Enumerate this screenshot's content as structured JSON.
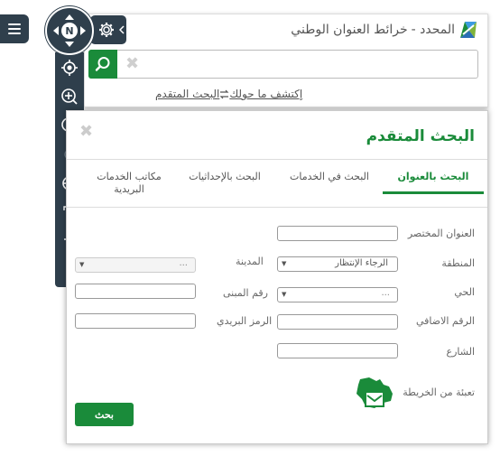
{
  "header": {
    "app_title": "خرائط العنوان الوطني",
    "title_suffix": "المحدد -",
    "compass_label": "N"
  },
  "search": {
    "value": "",
    "placeholder": "",
    "clear_symbol": "✖",
    "explore_link": "إكتشف ما حولك",
    "advanced_link": "البحث المتقدم"
  },
  "advanced_search": {
    "title": "البحث المتقدم",
    "close_symbol": "✖",
    "tabs": [
      {
        "label": "البحث بالعنوان",
        "active": true
      },
      {
        "label": "البحث في الخدمات",
        "active": false
      },
      {
        "label": "البحث بالإحداثيات",
        "active": false
      },
      {
        "label": "مكاتب الخدمات البريدية",
        "active": false
      }
    ],
    "fields": {
      "short_address_label": "العنوان المختصر",
      "region_label": "المنطقة",
      "region_value": "الرجاء الإنتظار",
      "city_label": "المدينة",
      "city_value": "...",
      "district_label": "الحي",
      "district_value": "...",
      "building_label": "رقم المبنى",
      "additional_label": "الرقم الاضافي",
      "postal_label": "الرمز البريدي",
      "street_label": "الشارع"
    },
    "map_fill_label": "تعبئة من الخريطة",
    "search_button": "بحث"
  },
  "icons": {
    "menu": "menu-icon",
    "gear": "gear-icon",
    "search": "search-icon",
    "locate": "locate-icon",
    "zoom_in": "zoom-in-icon"
  },
  "colors": {
    "accent": "#1a8b3a",
    "toolbar": "#2f3f4c"
  }
}
